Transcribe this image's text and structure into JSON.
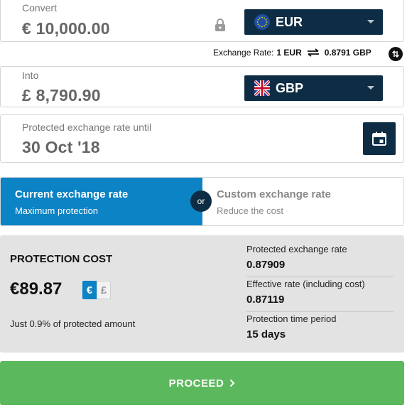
{
  "convert": {
    "label": "Convert",
    "amount": "€ 10,000.00",
    "currency": "EUR",
    "flag": "eu-flag"
  },
  "rate": {
    "prefix": "Exchange Rate:",
    "from": "1 EUR",
    "to": "0.8791 GBP"
  },
  "into": {
    "label": "Into",
    "amount": "£ 8,790.90",
    "currency": "GBP",
    "flag": "uk-flag"
  },
  "protection_date": {
    "label": "Protected exchange rate until",
    "value": "30 Oct '18"
  },
  "options": {
    "current": {
      "title": "Current exchange rate",
      "subtitle": "Maximum protection",
      "selected": true
    },
    "or": "or",
    "custom": {
      "title": "Custom exchange rate",
      "subtitle": "Reduce the cost",
      "selected": false
    }
  },
  "cost": {
    "title": "PROTECTION COST",
    "amount": "€89.87",
    "toggle_eur": "€",
    "toggle_gbp": "£",
    "note": "Just 0.9% of protected amount"
  },
  "stats": [
    {
      "label": "Protected exchange rate",
      "value": "0.87909"
    },
    {
      "label": "Effective rate (including cost)",
      "value": "0.87119"
    },
    {
      "label": "Protection time period",
      "value": "15 days"
    }
  ],
  "proceed": {
    "label": "PROCEED"
  },
  "colors": {
    "navy": "#0e2d44",
    "blue": "#0b83c4",
    "green": "#5cb85c",
    "panel": "#e3e3e3"
  }
}
